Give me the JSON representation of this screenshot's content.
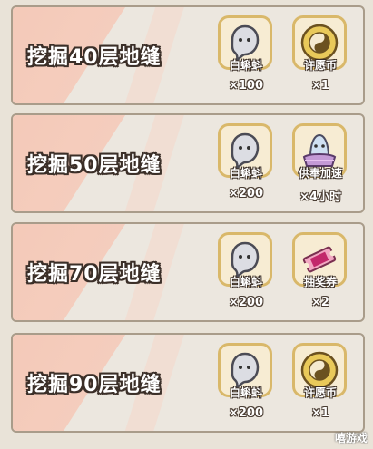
{
  "rows": [
    {
      "title": "挖掘40层地缝",
      "rewards": [
        {
          "name": "白蝌蚪",
          "qty": "×100",
          "icon": "ghost-tadpole-icon"
        },
        {
          "name": "许愿币",
          "qty": "×1",
          "icon": "wish-coin-icon"
        }
      ]
    },
    {
      "title": "挖掘50层地缝",
      "rewards": [
        {
          "name": "白蝌蚪",
          "qty": "×200",
          "icon": "ghost-tadpole-icon"
        },
        {
          "name": "供奉加速",
          "qty": "×4小时",
          "icon": "offering-boost-icon"
        }
      ]
    },
    {
      "title": "挖掘70层地缝",
      "rewards": [
        {
          "name": "白蝌蚪",
          "qty": "×200",
          "icon": "ghost-tadpole-icon"
        },
        {
          "name": "抽奖券",
          "qty": "×2",
          "icon": "lottery-ticket-icon"
        }
      ]
    },
    {
      "title": "挖掘90层地缝",
      "rewards": [
        {
          "name": "白蝌蚪",
          "qty": "×200",
          "icon": "ghost-tadpole-icon"
        },
        {
          "name": "许愿币",
          "qty": "×1",
          "icon": "wish-coin-icon"
        }
      ]
    }
  ],
  "watermark": "嘻游戏"
}
